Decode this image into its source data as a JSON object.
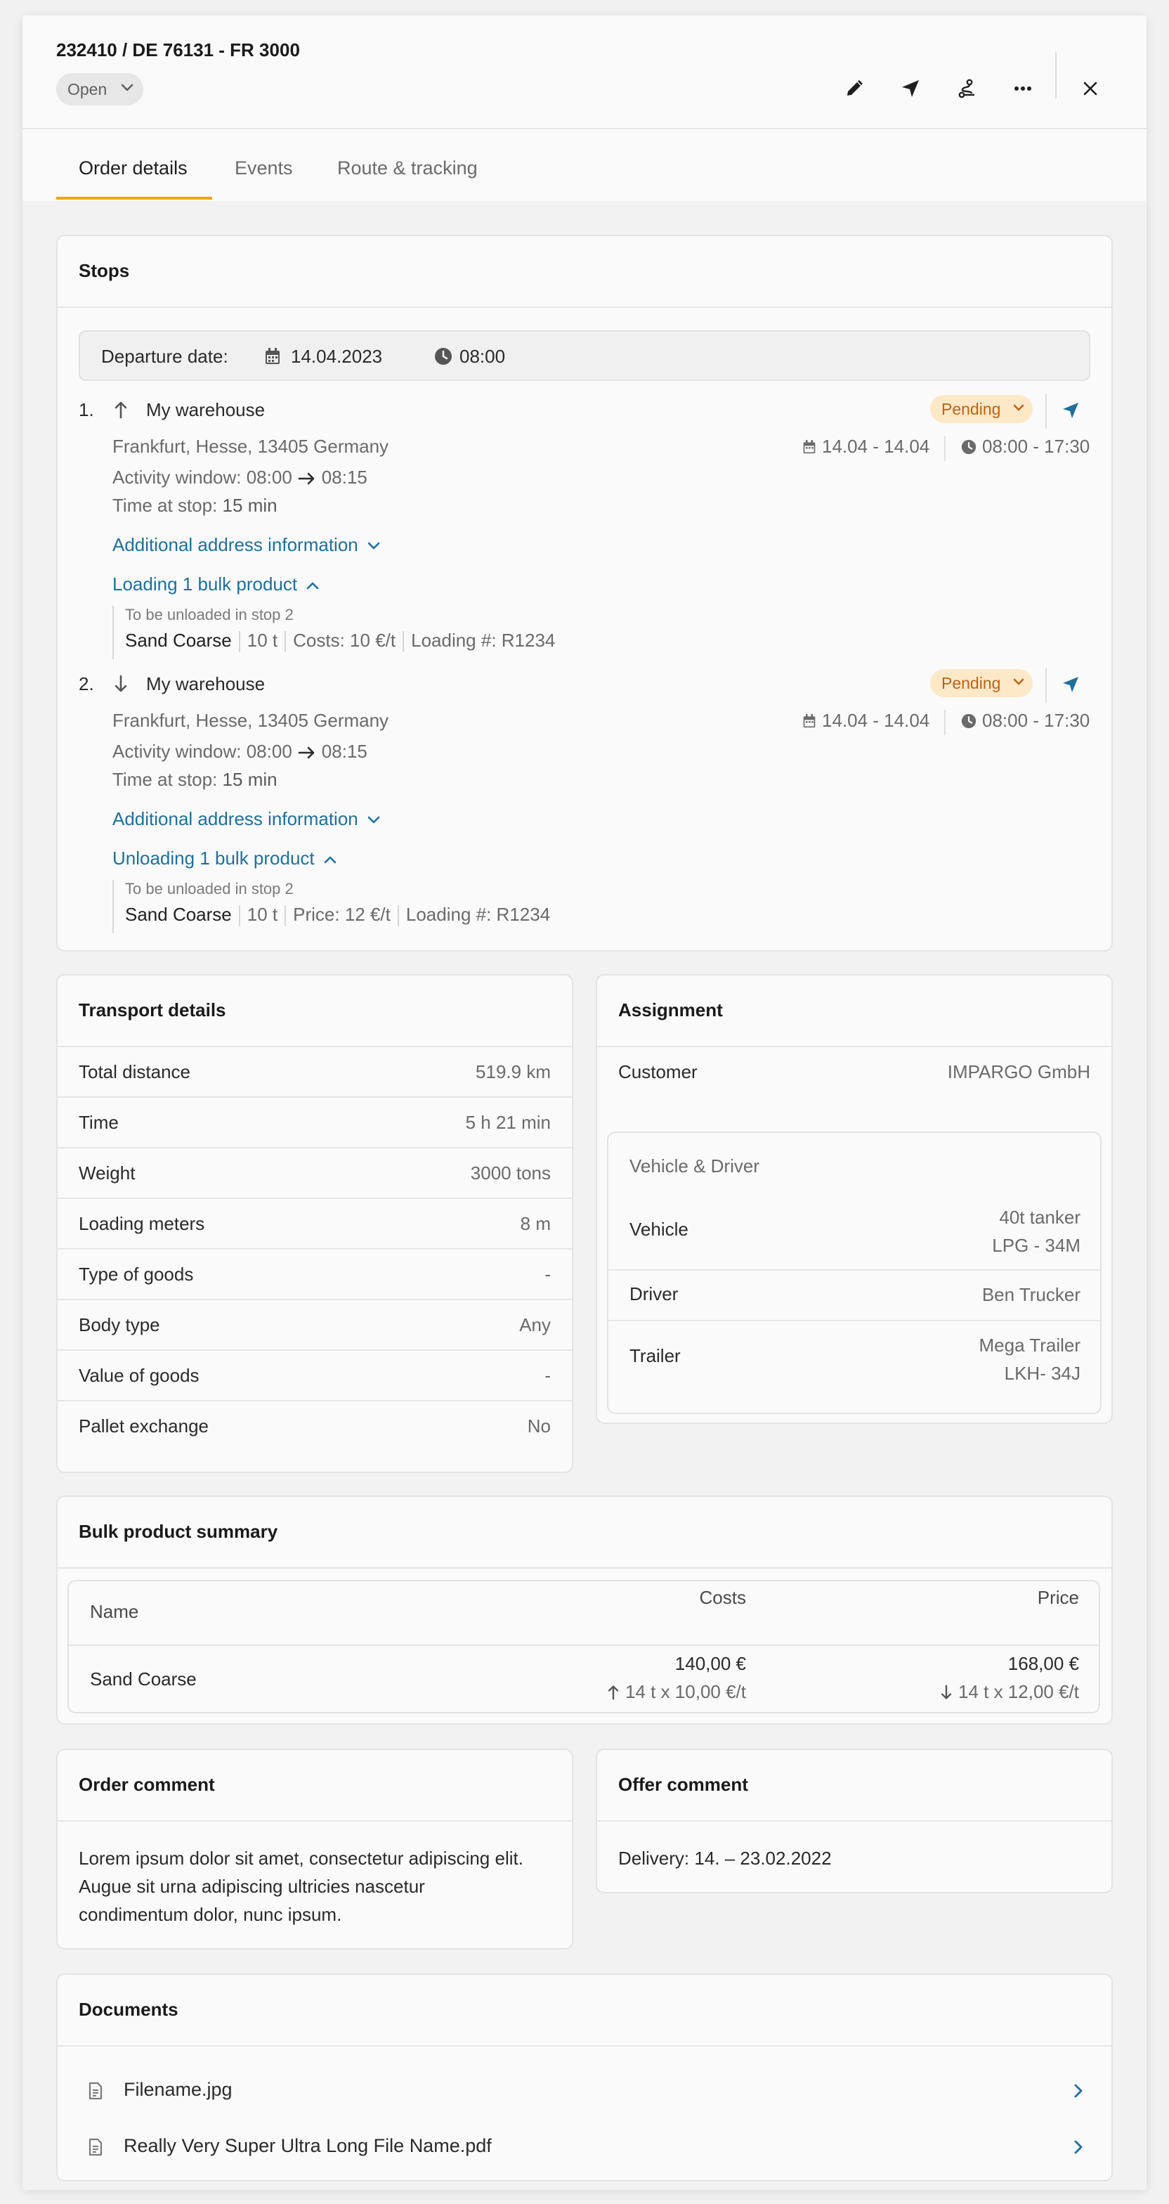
{
  "header": {
    "order_title": "232410 / DE 76131 - FR 3000",
    "status": "Open",
    "actions": [
      "edit-icon",
      "send-icon",
      "route-icon",
      "more-icon",
      "close-icon"
    ]
  },
  "tabs": [
    {
      "label": "Order details",
      "active": true
    },
    {
      "label": "Events",
      "active": false
    },
    {
      "label": "Route & tracking",
      "active": false
    }
  ],
  "stops": {
    "title": "Stops",
    "departure": {
      "label": "Departure date:",
      "date": "14.04.2023",
      "time": "08:00"
    },
    "items": [
      {
        "num": "1.",
        "direction": "up",
        "name": "My warehouse",
        "status": "Pending",
        "address": "Frankfurt, Hesse, 13405 Germany",
        "date_range": "14.04 - 14.04",
        "time_range": "08:00 - 17:30",
        "activity_label": "Activity window: 08:00",
        "activity_end": "08:15",
        "time_at_stop_label": "Time at stop:",
        "time_at_stop_value": "15 min",
        "address_info_link": "Additional address information",
        "product_link": "Loading 1 bulk product",
        "product_note": "To be unloaded in stop 2",
        "product_name": "Sand Coarse",
        "product_qty": "10 t",
        "product_money": "Costs: 10 €/t",
        "product_ref": "Loading #: R1234"
      },
      {
        "num": "2.",
        "direction": "down",
        "name": "My warehouse",
        "status": "Pending",
        "address": "Frankfurt, Hesse, 13405 Germany",
        "date_range": "14.04 - 14.04",
        "time_range": "08:00 - 17:30",
        "activity_label": "Activity window: 08:00",
        "activity_end": "08:15",
        "time_at_stop_label": "Time at stop:",
        "time_at_stop_value": "15 min",
        "address_info_link": "Additional address information",
        "product_link": "Unloading 1 bulk product",
        "product_note": "To be unloaded in stop 2",
        "product_name": "Sand Coarse",
        "product_qty": "10 t",
        "product_money": "Price: 12 €/t",
        "product_ref": "Loading #: R1234"
      }
    ]
  },
  "transport": {
    "title": "Transport details",
    "rows": [
      {
        "k": "Total distance",
        "v": "519.9 km"
      },
      {
        "k": "Time",
        "v": "5 h 21 min"
      },
      {
        "k": "Weight",
        "v": "3000 tons"
      },
      {
        "k": "Loading meters",
        "v": "8 m"
      },
      {
        "k": "Type of goods",
        "v": "-"
      },
      {
        "k": "Body type",
        "v": "Any"
      },
      {
        "k": "Value of goods",
        "v": "-"
      },
      {
        "k": "Pallet exchange",
        "v": "No"
      }
    ]
  },
  "assignment": {
    "title": "Assignment",
    "customer_label": "Customer",
    "customer_value": "IMPARGO GmbH",
    "vehicle_driver_title": "Vehicle & Driver",
    "vehicle_label": "Vehicle",
    "vehicle_line1": "40t tanker",
    "vehicle_line2": "LPG - 34M",
    "driver_label": "Driver",
    "driver_value": "Ben Trucker",
    "trailer_label": "Trailer",
    "trailer_line1": "Mega Trailer",
    "trailer_line2": "LKH- 34J"
  },
  "bulk": {
    "title": "Bulk product summary",
    "col_name": "Name",
    "col_costs": "Costs",
    "col_price": "Price",
    "row": {
      "name": "Sand Coarse",
      "costs": "140,00 €",
      "costs_detail": "14 t x 10,00 €/t",
      "price": "168,00 €",
      "price_detail": "14 t x 12,00 €/t"
    }
  },
  "order_comment": {
    "title": "Order comment",
    "text": "Lorem ipsum dolor sit amet, consectetur adipiscing elit. Augue sit urna adipiscing ultricies nascetur condimentum dolor, nunc ipsum."
  },
  "offer_comment": {
    "title": "Offer comment",
    "text": "Delivery: 14. – 23.02.2022"
  },
  "documents": {
    "title": "Documents",
    "files": [
      "Filename.jpg",
      "Really Very Super Ultra Long File Name.pdf"
    ]
  },
  "colors": {
    "accent_tab": "#f0a500",
    "link": "#1f6f9a",
    "pending_bg": "#fde8c8",
    "pending_text": "#b8651a"
  }
}
